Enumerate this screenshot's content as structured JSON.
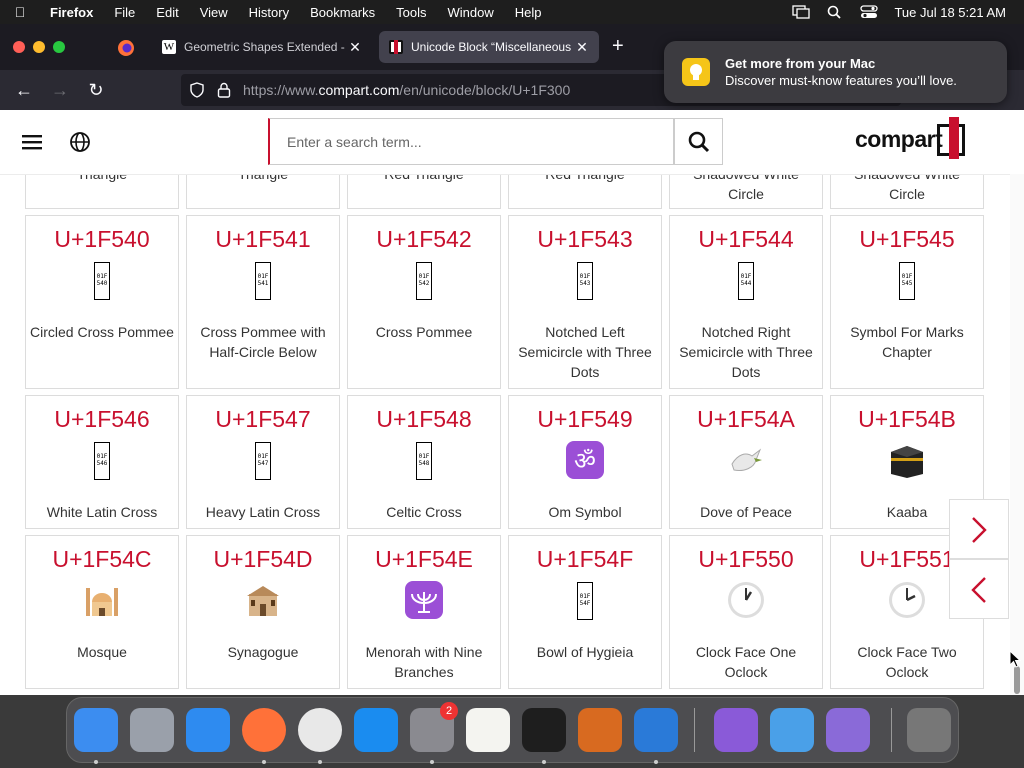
{
  "menubar": {
    "app": "Firefox",
    "items": [
      "File",
      "Edit",
      "View",
      "History",
      "Bookmarks",
      "Tools",
      "Window",
      "Help"
    ],
    "clock": "Tue Jul 18  5:21 AM"
  },
  "tabs": [
    {
      "label": "Geometric Shapes Extended - W"
    },
    {
      "label": "Unicode Block “Miscellaneous S"
    }
  ],
  "url": {
    "prefix": "https://www.",
    "domain": "compart.com",
    "path": "/en/unicode/block/U+1F300"
  },
  "notification": {
    "title": "Get more from your Mac",
    "body": "Discover must-know features you’ll love."
  },
  "site": {
    "search_placeholder": "Enter a search term...",
    "logo": "compart"
  },
  "partial_row": [
    {
      "name": "Triangle"
    },
    {
      "name": "Triangle"
    },
    {
      "name": "Red Triangle"
    },
    {
      "name": "Red Triangle"
    },
    {
      "name": "Shadowed White Circle"
    },
    {
      "name": "Shadowed White Circle"
    }
  ],
  "rows": [
    [
      {
        "code": "U+1F540",
        "name": "Circled Cross Pommee",
        "tofu": [
          "01F",
          "540"
        ]
      },
      {
        "code": "U+1F541",
        "name": "Cross Pommee with Half-Circle Below",
        "tofu": [
          "01F",
          "541"
        ]
      },
      {
        "code": "U+1F542",
        "name": "Cross Pommee",
        "tofu": [
          "01F",
          "542"
        ]
      },
      {
        "code": "U+1F543",
        "name": "Notched Left Semicircle with Three Dots",
        "tofu": [
          "01F",
          "543"
        ]
      },
      {
        "code": "U+1F544",
        "name": "Notched Right Semicircle with Three Dots",
        "tofu": [
          "01F",
          "544"
        ]
      },
      {
        "code": "U+1F545",
        "name": "Symbol For Marks Chapter",
        "tofu": [
          "01F",
          "545"
        ]
      }
    ],
    [
      {
        "code": "U+1F546",
        "name": "White Latin Cross",
        "tofu": [
          "01F",
          "546"
        ]
      },
      {
        "code": "U+1F547",
        "name": "Heavy Latin Cross",
        "tofu": [
          "01F",
          "547"
        ]
      },
      {
        "code": "U+1F548",
        "name": "Celtic Cross",
        "tofu": [
          "01F",
          "548"
        ]
      },
      {
        "code": "U+1F549",
        "name": "Om Symbol",
        "icon": "om-icon"
      },
      {
        "code": "U+1F54A",
        "name": "Dove of Peace",
        "icon": "dove-icon"
      },
      {
        "code": "U+1F54B",
        "name": "Kaaba",
        "icon": "kaaba-icon"
      }
    ],
    [
      {
        "code": "U+1F54C",
        "name": "Mosque",
        "icon": "mosque-icon"
      },
      {
        "code": "U+1F54D",
        "name": "Synagogue",
        "icon": "synagogue-icon"
      },
      {
        "code": "U+1F54E",
        "name": "Menorah with Nine Branches",
        "icon": "menorah-icon"
      },
      {
        "code": "U+1F54F",
        "name": "Bowl of Hygieia",
        "tofu": [
          "01F",
          "54F"
        ]
      },
      {
        "code": "U+1F550",
        "name": "Clock Face One Oclock",
        "icon": "clock-one-icon"
      },
      {
        "code": "U+1F551",
        "name": "Clock Face Two Oclock",
        "icon": "clock-two-icon"
      }
    ]
  ],
  "dock": {
    "settings_badge": "2",
    "apps": [
      "finder-icon",
      "launchpad-icon",
      "safari-icon",
      "firefox-icon",
      "chrome-icon",
      "app-store-icon",
      "system-settings-icon",
      "textedit-icon",
      "terminal-icon",
      "garageband-icon",
      "vscode-icon",
      "visual-studio-icon",
      "weather-icon",
      "simulator-icon",
      "trash-icon"
    ]
  }
}
